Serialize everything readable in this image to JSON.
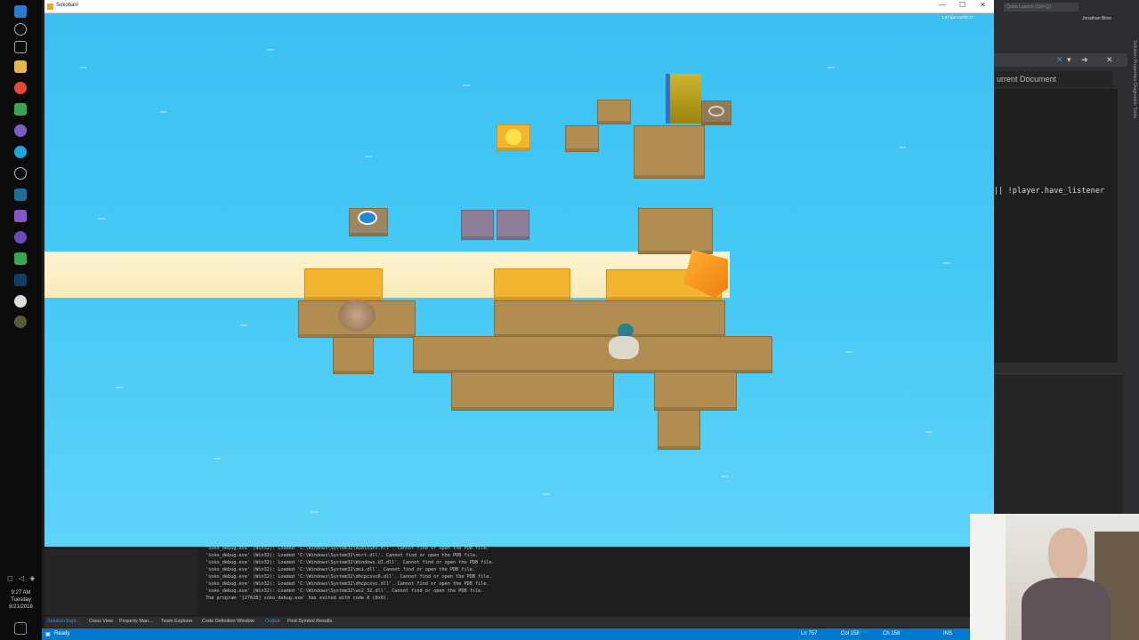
{
  "game_window": {
    "title": "Sokoban!",
    "controls": [
      "—",
      "☐",
      "✕"
    ],
    "hud_fps": "7.37 fps  0.57/0.77"
  },
  "vs": {
    "quick_launch": "Quick Launch (Ctrl+Q)",
    "user": "Jonathan Blow",
    "document_header": "urrent Document",
    "code_line": "|| !player.have_listener",
    "side_tabs": "Solution  Properties  Diagnostic Tools"
  },
  "output": {
    "lines": [
      "'soko_debug.exe' (Win32): Loaded 'C:\\Windows\\System32\\AudioSes.dll'. Cannot find or open the PDB file.",
      "'soko_debug.exe' (Win32): Loaded 'C:\\Windows\\System32\\msrt.dll'. Cannot find or open the PDB file.",
      "'soko_debug.exe' (Win32): Loaded 'C:\\Windows\\System32\\Windows.UI.dll'. Cannot find or open the PDB file.",
      "'soko_debug.exe' (Win32): Loaded 'C:\\Windows\\System32\\msi.dll'. Cannot find or open the PDB file.",
      "'soko_debug.exe' (Win32): Loaded 'C:\\Windows\\System32\\dhcpcsvc6.dll'. Cannot find or open the PDB file.",
      "'soko_debug.exe' (Win32): Loaded 'C:\\Windows\\System32\\dhcpcsvc.dll'. Cannot find or open the PDB file.",
      "'soko_debug.exe' (Win32): Loaded 'C:\\Windows\\System32\\ws2_32.dll'. Cannot find or open the PDB file.",
      "The program '[27628] soko_debug.exe' has exited with code 0 (0x0)."
    ]
  },
  "bottom_tabs": [
    "Solution Expl...",
    "Class View",
    "Property Man...",
    "Team Explorer",
    "Code Definition Window",
    "Output",
    "Find Symbol Results"
  ],
  "status": {
    "ready": "Ready",
    "ln": "Ln 757",
    "col": "Col 158",
    "ch": "Ch 158",
    "ins": "INS"
  },
  "clock": {
    "time": "9:27 AM",
    "day": "Tuesday",
    "date": "8/21/2018"
  },
  "colors": {
    "water": "#45c9f5",
    "tile": "#b18d52",
    "highlight": "#f3b52f",
    "vs_accent": "#007acc"
  }
}
